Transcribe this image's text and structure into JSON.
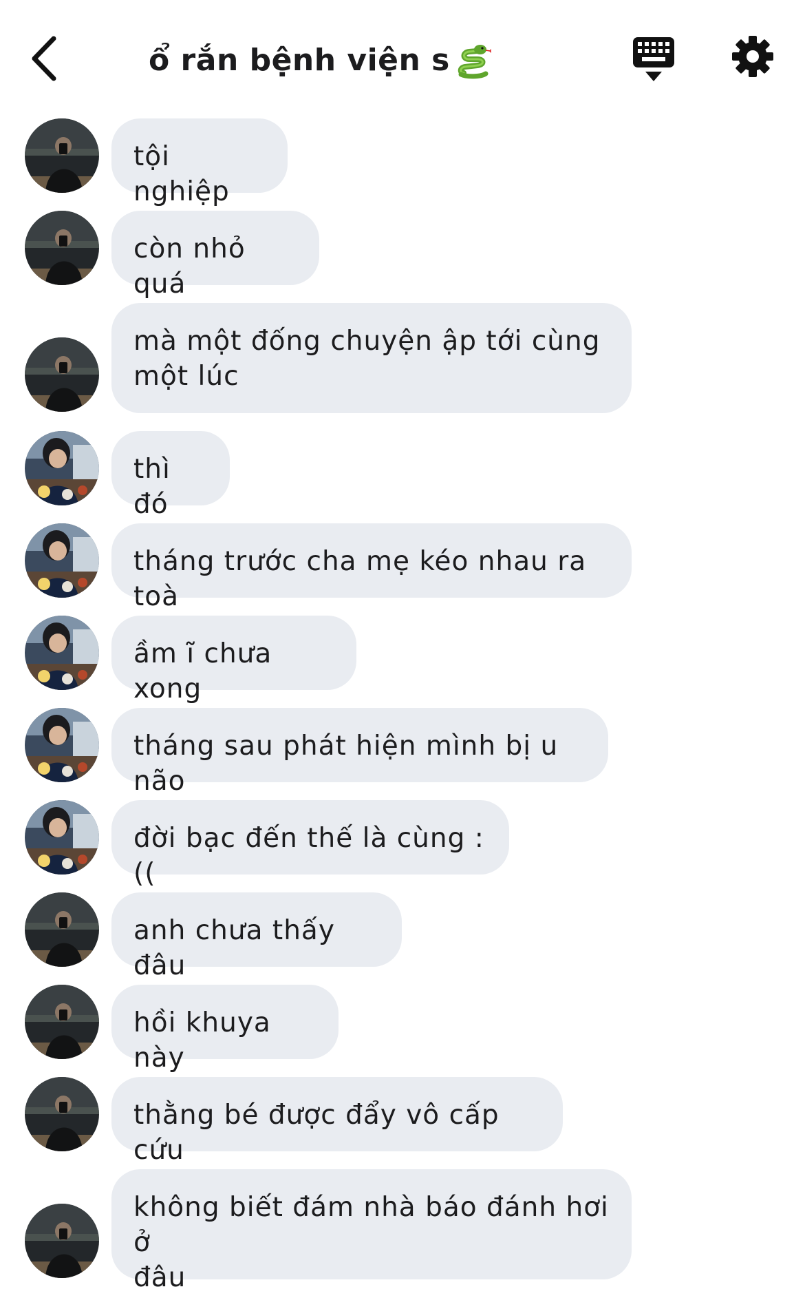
{
  "header": {
    "title": "ổ rắn bệnh viện s",
    "title_emoji": "snake-emoji",
    "back_icon": "chevron-left-icon",
    "keyboard_icon": "keyboard-icon",
    "settings_icon": "gear-icon"
  },
  "colors": {
    "bubble": "#e9ecf1",
    "text": "#1c1c1e",
    "background": "#ffffff"
  },
  "messages": [
    {
      "sender": "user-a",
      "text": "tội nghiệp"
    },
    {
      "sender": "user-a",
      "text": "còn nhỏ quá"
    },
    {
      "sender": "user-a",
      "text": "mà một đống chuyện ập tới cùng\nmột lúc"
    },
    {
      "sender": "user-b",
      "text": "thì đó"
    },
    {
      "sender": "user-b",
      "text": "tháng trước cha mẹ kéo nhau ra toà"
    },
    {
      "sender": "user-b",
      "text": "ầm ĩ chưa xong"
    },
    {
      "sender": "user-b",
      "text": "tháng sau phát hiện mình bị u não"
    },
    {
      "sender": "user-b",
      "text": "đời bạc đến thế là cùng :(("
    },
    {
      "sender": "user-a",
      "text": "anh chưa thấy đâu"
    },
    {
      "sender": "user-a",
      "text": "hồi khuya này"
    },
    {
      "sender": "user-a",
      "text": "thằng bé được đẩy vô cấp cứu"
    },
    {
      "sender": "user-a",
      "text": "không biết đám nhà báo đánh hơi ở\nđâu"
    }
  ]
}
